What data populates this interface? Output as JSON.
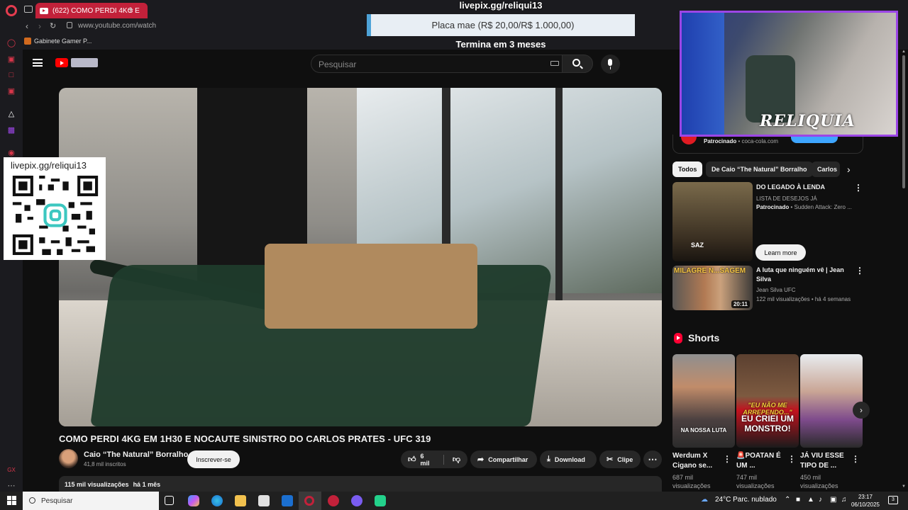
{
  "browser": {
    "tab_title": "(622) COMO PERDI 4KG E",
    "url": "www.youtube.com/watch",
    "bookmark": "Gabinete Gamer P..."
  },
  "youtube": {
    "search_placeholder": "Pesquisar"
  },
  "video": {
    "title": "COMO PERDI 4KG EM 1H30 E NOCAUTE SINISTRO DO CARLOS PRATES - UFC 319",
    "channel": "Caio “The Natural” Borralho",
    "subscribers": "41,8 mil inscritos",
    "subscribe_label": "Inscrever-se",
    "likes": "6 mil",
    "share_label": "Compartilhar",
    "download_label": "Download",
    "clip_label": "Clipe",
    "views": "115 mil visualizações",
    "age": "há 1 mês"
  },
  "overlay": {
    "url_top": "livepix.gg/reliqui13",
    "goal": "Placa mae (R$ 20,00/R$ 1.000,00)",
    "ends": "Termina em 3 meses",
    "qr_url": "livepix.gg/reliqui13",
    "webcam_label": "RELIQUIA"
  },
  "sidebar": {
    "ad_sponsored": "Patrocinado",
    "ad_domain": "coca-cola.com",
    "chips": [
      "Todos",
      "De Caio “The Natural” Borralho",
      "Carlos"
    ],
    "recs": [
      {
        "title": "DO LEGADO À LENDA",
        "line1": "LISTA DE DESEJOS JÁ",
        "sponsored": "Patrocinado",
        "line2": "Sudden Attack: Zero ...",
        "thumb_text": "SAZ",
        "cta": "Learn more"
      },
      {
        "title_l1": "A luta que ninguém vê | Jean",
        "title_l2": "Silva",
        "channel": "Jean Silva UFC",
        "meta": "122 mil visualizações • há 4 semanas",
        "thumb_text": "MILAGRE N...SAGEM",
        "duration": "20:11"
      }
    ],
    "shorts_heading": "Shorts",
    "shorts": [
      {
        "title_l1": "Werdum X",
        "title_l2": "Cigano se...",
        "views_l1": "687 mil",
        "views_l2": "visualizações",
        "caption": "NA NOSSA LUTA"
      },
      {
        "title_l1": "🚨POATAN É",
        "title_l2": "UM ...",
        "views_l1": "747 mil",
        "views_l2": "visualizações",
        "caption1": "\"EU NÃO ME ARREPENDO...\"",
        "caption2": "EU CRIEI UM MONSTRO!"
      },
      {
        "title_l1": "JÁ VIU ESSE",
        "title_l2": "TIPO DE ...",
        "views_l1": "450 mil",
        "views_l2": "visualizações"
      }
    ]
  },
  "taskbar": {
    "search_placeholder": "Pesquisar",
    "weather": "24°C  Parc. nublado",
    "time": "23:17",
    "date": "06/10/2025",
    "notifications": "3"
  },
  "colors": {
    "accent_red": "#ff0000",
    "opera_red": "#c2213a",
    "webcam_border": "#9c46e6",
    "link_blue": "#3ea6ff"
  }
}
